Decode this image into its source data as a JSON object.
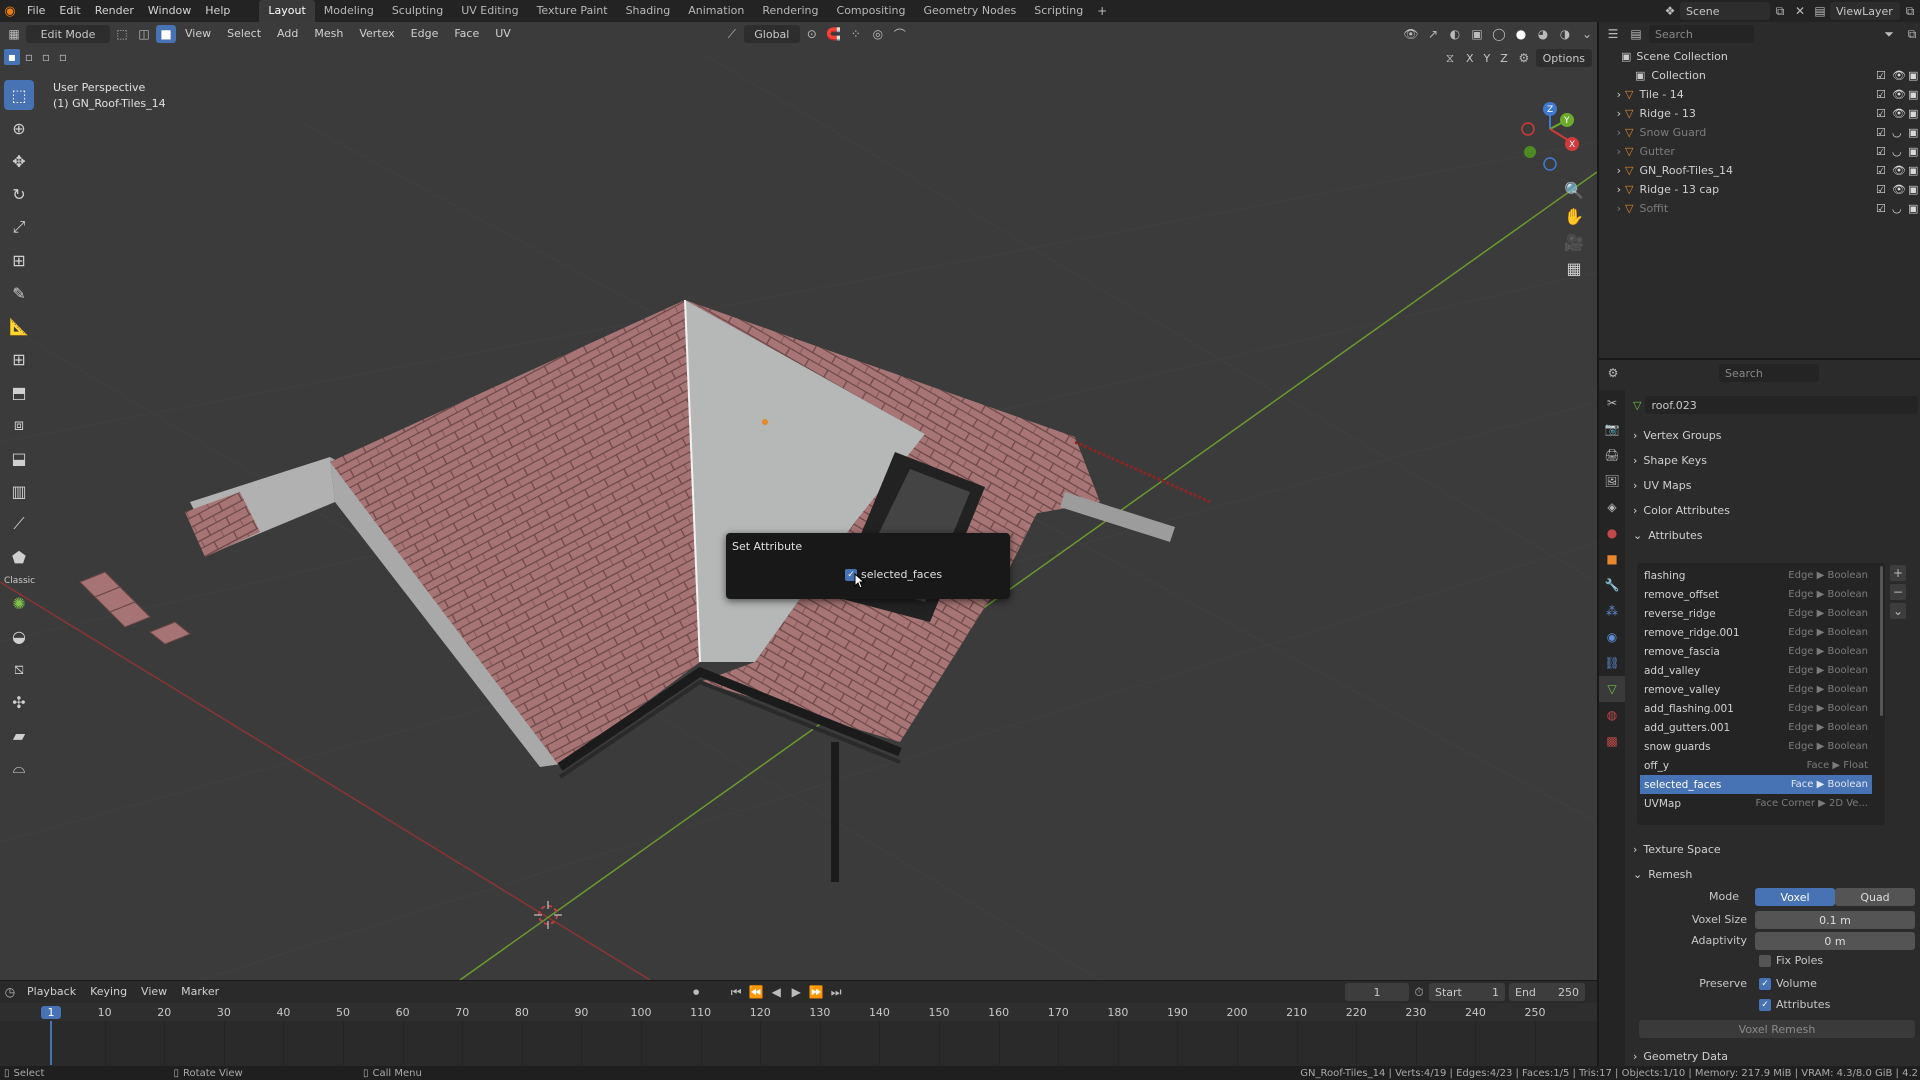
{
  "menubar": {
    "menus": [
      "File",
      "Edit",
      "Render",
      "Window",
      "Help"
    ],
    "workspaces": [
      "Layout",
      "Modeling",
      "Sculpting",
      "UV Editing",
      "Texture Paint",
      "Shading",
      "Animation",
      "Rendering",
      "Compositing",
      "Geometry Nodes",
      "Scripting"
    ],
    "active_workspace": "Layout",
    "scene": "Scene",
    "view_layer": "ViewLayer"
  },
  "viewport": {
    "mode": "Edit Mode",
    "menus": [
      "View",
      "Select",
      "Add",
      "Mesh",
      "Vertex",
      "Edge",
      "Face",
      "UV"
    ],
    "orientation": "Global",
    "axes": [
      "X",
      "Y",
      "Z"
    ],
    "options_label": "Options",
    "overlay_line1": "User Perspective",
    "overlay_line2": "(1) GN_Roof-Tiles_14",
    "mirror_label": "Classic",
    "gizmo_axes": [
      "Z",
      "Y",
      "X"
    ]
  },
  "popup": {
    "title": "Set Attribute",
    "checkbox_label": "selected_faces",
    "checked": true
  },
  "timeline": {
    "menus": [
      "Playback",
      "Keying",
      "View",
      "Marker"
    ],
    "current_frame": "1",
    "start_label": "Start",
    "start": "1",
    "end_label": "End",
    "end": "250",
    "ticks": [
      "1",
      "10",
      "20",
      "30",
      "40",
      "50",
      "60",
      "70",
      "80",
      "90",
      "100",
      "110",
      "120",
      "130",
      "140",
      "150",
      "160",
      "170",
      "180",
      "190",
      "200",
      "210",
      "220",
      "230",
      "240",
      "250"
    ]
  },
  "statusbar": {
    "select": "Select",
    "rotate": "Rotate View",
    "call_menu": "Call Menu",
    "stats": "GN_Roof-Tiles_14 | Verts:4/19 | Edges:4/23 | Faces:1/5 | Tris:17 | Objects:1/10 | Memory: 217.9 MiB | VRAM: 4.3/8.0 GiB | 4.2"
  },
  "outliner": {
    "search_placeholder": "Search",
    "root": "Scene Collection",
    "items": [
      {
        "name": "Collection",
        "dim": false
      },
      {
        "name": "Tile - 14",
        "dim": false
      },
      {
        "name": "Ridge - 13",
        "dim": false
      },
      {
        "name": "Snow Guard",
        "dim": true
      },
      {
        "name": "Gutter",
        "dim": true
      },
      {
        "name": "GN_Roof-Tiles_14",
        "dim": false
      },
      {
        "name": "Ridge - 13 cap",
        "dim": false
      },
      {
        "name": "Soffit",
        "dim": true
      }
    ]
  },
  "properties": {
    "search_placeholder": "Search",
    "mesh_name": "roof.023",
    "panels": [
      "Vertex Groups",
      "Shape Keys",
      "UV Maps",
      "Color Attributes",
      "Attributes"
    ],
    "attributes": [
      {
        "name": "flashing",
        "domain": "Edge ▶ Boolean"
      },
      {
        "name": "remove_offset",
        "domain": "Edge ▶ Boolean"
      },
      {
        "name": "reverse_ridge",
        "domain": "Edge ▶ Boolean"
      },
      {
        "name": "remove_ridge.001",
        "domain": "Edge ▶ Boolean"
      },
      {
        "name": "remove_fascia",
        "domain": "Edge ▶ Boolean"
      },
      {
        "name": "add_valley",
        "domain": "Edge ▶ Boolean"
      },
      {
        "name": "remove_valley",
        "domain": "Edge ▶ Boolean"
      },
      {
        "name": "add_flashing.001",
        "domain": "Edge ▶ Boolean"
      },
      {
        "name": "add_gutters.001",
        "domain": "Edge ▶ Boolean"
      },
      {
        "name": "snow guards",
        "domain": "Edge ▶ Boolean"
      },
      {
        "name": "off_y",
        "domain": "Face ▶ Float"
      },
      {
        "name": "selected_faces",
        "domain": "Face ▶ Boolean"
      },
      {
        "name": "UVMap",
        "domain": "Face Corner ▶ 2D Ve..."
      }
    ],
    "selected_attribute": "selected_faces",
    "texture_space": "Texture Space",
    "remesh": {
      "title": "Remesh",
      "mode_label": "Mode",
      "mode_options": [
        "Voxel",
        "Quad"
      ],
      "voxel_size_label": "Voxel Size",
      "voxel_size": "0.1 m",
      "adaptivity_label": "Adaptivity",
      "adaptivity": "0 m",
      "fix_poles": "Fix Poles",
      "preserve_label": "Preserve",
      "volume": "Volume",
      "attributes": "Attributes",
      "voxel_remesh": "Voxel Remesh"
    },
    "geometry_data": "Geometry Data"
  }
}
